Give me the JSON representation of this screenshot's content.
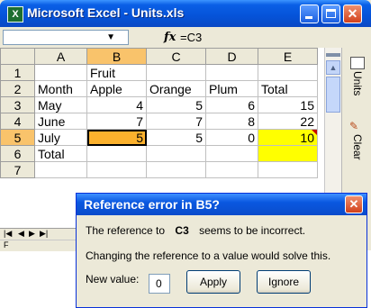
{
  "window": {
    "title": "Microsoft Excel - Units.xls",
    "app_icon": "X"
  },
  "formula_bar": {
    "fx": "fx",
    "formula": "=C3"
  },
  "sheet": {
    "columns": [
      "",
      "A",
      "B",
      "C",
      "D",
      "E"
    ],
    "rows": [
      {
        "n": "1",
        "cells": [
          "",
          "Fruit",
          "",
          "",
          ""
        ]
      },
      {
        "n": "2",
        "cells": [
          "Month",
          "Apple",
          "Orange",
          "Plum",
          "Total"
        ]
      },
      {
        "n": "3",
        "cells": [
          "May",
          "4",
          "5",
          "6",
          "15"
        ]
      },
      {
        "n": "4",
        "cells": [
          "June",
          "7",
          "7",
          "8",
          "22"
        ]
      },
      {
        "n": "5",
        "cells": [
          "July",
          "5",
          "5",
          "0",
          "10"
        ]
      },
      {
        "n": "6",
        "cells": [
          "Total",
          "",
          "",
          "",
          ""
        ]
      },
      {
        "n": "7",
        "cells": [
          "",
          "",
          "",
          "",
          ""
        ]
      }
    ],
    "status_left": "F"
  },
  "side_pane": {
    "units_label": "Units",
    "clear_label": "Clear"
  },
  "dialog": {
    "title": "Reference error in B5?",
    "line1_pre": "The reference to",
    "line1_ref": "C3",
    "line1_post": "seems to be incorrect.",
    "line2": "Changing the reference to a value would solve this.",
    "new_value_label": "New value:",
    "new_value": "0",
    "apply_label": "Apply",
    "ignore_label": "Ignore"
  },
  "colors": {
    "highlight_yellow": "#ffff00",
    "selected_orange": "#fbb12d",
    "title_blue": "#0553d8"
  }
}
